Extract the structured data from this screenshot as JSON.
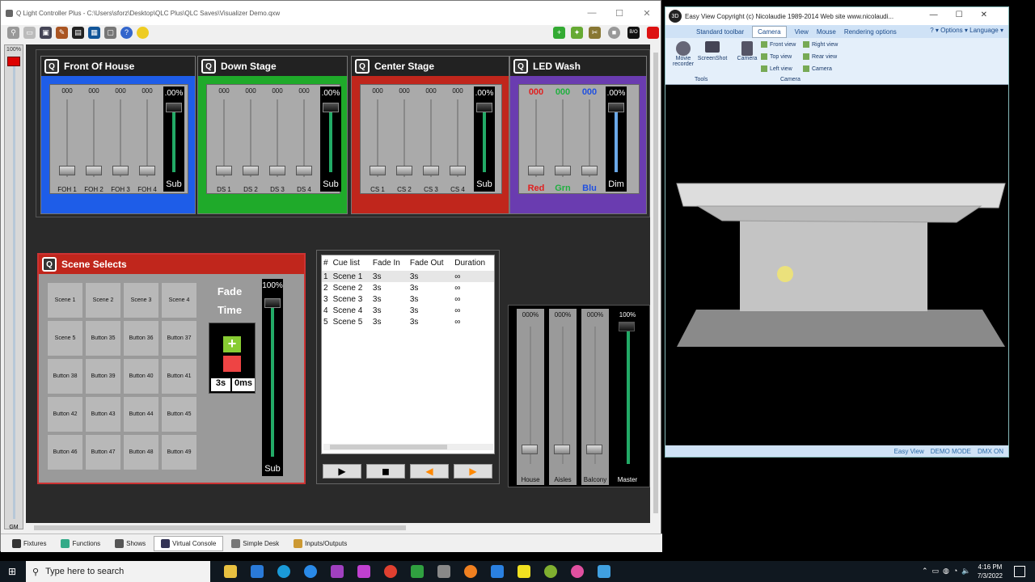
{
  "qlc": {
    "title": "Q Light Controller Plus - C:\\Users\\sforz\\Desktop\\QLC Plus\\QLC Saves\\Visualizer Demo.qxw",
    "gm": {
      "percent": "100%",
      "label": "GM"
    },
    "frames": [
      {
        "title": "Front Of House",
        "color": "#1e5de8",
        "sliders": [
          {
            "value": "000",
            "name": "FOH 1"
          },
          {
            "value": "000",
            "name": "FOH 2"
          },
          {
            "value": "000",
            "name": "FOH 3"
          },
          {
            "value": "000",
            "name": "FOH 4"
          }
        ],
        "sub": {
          "value": ".00%",
          "name": "Sub"
        }
      },
      {
        "title": "Down Stage",
        "color": "#1faa2a",
        "sliders": [
          {
            "value": "000",
            "name": "DS 1"
          },
          {
            "value": "000",
            "name": "DS 2"
          },
          {
            "value": "000",
            "name": "DS 3"
          },
          {
            "value": "000",
            "name": "DS 4"
          }
        ],
        "sub": {
          "value": ".00%",
          "name": "Sub"
        }
      },
      {
        "title": "Center Stage",
        "color": "#c0261c",
        "sliders": [
          {
            "value": "000",
            "name": "CS 1"
          },
          {
            "value": "000",
            "name": "CS 2"
          },
          {
            "value": "000",
            "name": "CS 3"
          },
          {
            "value": "000",
            "name": "CS 4"
          }
        ],
        "sub": {
          "value": ".00%",
          "name": "Sub"
        }
      },
      {
        "title": "LED Wash",
        "color": "#6a3cb0",
        "sliders": [
          {
            "value": "000",
            "name": "Red",
            "color": "#e02020"
          },
          {
            "value": "000",
            "name": "Grn",
            "color": "#20b040"
          },
          {
            "value": "000",
            "name": "Blu",
            "color": "#2050e0"
          }
        ],
        "sub": {
          "value": ".00%",
          "name": "Dim"
        }
      }
    ],
    "scene_selects": {
      "title": "Scene Selects",
      "buttons": [
        "Scene 1",
        "Scene 2",
        "Scene 3",
        "Scene 4",
        "Scene 5",
        "Button 35",
        "Button 36",
        "Button 37",
        "Button 38",
        "Button 39",
        "Button 40",
        "Button 41",
        "Button 42",
        "Button 43",
        "Button 44",
        "Button 45",
        "Button 46",
        "Button 47",
        "Button 48",
        "Button 49"
      ],
      "fade_label": "Fade",
      "time_label": "Time",
      "fade_value": "3s",
      "fade_ms": "0ms",
      "sub": {
        "value": "100%",
        "name": "Sub"
      }
    },
    "cue_list": {
      "headers": [
        "#",
        "Cue list",
        "Fade In",
        "Fade Out",
        "Duration"
      ],
      "rows": [
        [
          "1",
          "Scene 1",
          "3s",
          "3s",
          "∞"
        ],
        [
          "2",
          "Scene 2",
          "3s",
          "3s",
          "∞"
        ],
        [
          "3",
          "Scene 3",
          "3s",
          "3s",
          "∞"
        ],
        [
          "4",
          "Scene 4",
          "3s",
          "3s",
          "∞"
        ],
        [
          "5",
          "Scene 5",
          "3s",
          "3s",
          "∞"
        ]
      ]
    },
    "house": [
      {
        "value": "000%",
        "name": "House"
      },
      {
        "value": "000%",
        "name": "Aisles"
      },
      {
        "value": "000%",
        "name": "Balcony"
      },
      {
        "value": "100%",
        "name": "Master"
      }
    ],
    "tabs": [
      "Fixtures",
      "Functions",
      "Shows",
      "Virtual Console",
      "Simple Desk",
      "Inputs/Outputs"
    ]
  },
  "easyview": {
    "title": "Easy View  Copyright (c) Nicolaudie 1989-2014   Web site www.nicolaudi...",
    "tabs": [
      "Standard toolbar",
      "Camera",
      "View",
      "Mouse",
      "Rendering options"
    ],
    "right_menu": [
      "Options",
      "Language"
    ],
    "tools": [
      "Movie recorder",
      "ScreenShot"
    ],
    "tools_label": "Tools",
    "camera_btn": "Camera",
    "camera_label": "Camera",
    "views": [
      "Front view",
      "Top view",
      "Left view",
      "Right view",
      "Rear view",
      "Camera"
    ],
    "status": [
      "Easy View",
      "DEMO MODE",
      "DMX ON"
    ]
  },
  "taskbar": {
    "search": "Type here to search",
    "time": "4:16 PM",
    "date": "7/3/2022"
  }
}
